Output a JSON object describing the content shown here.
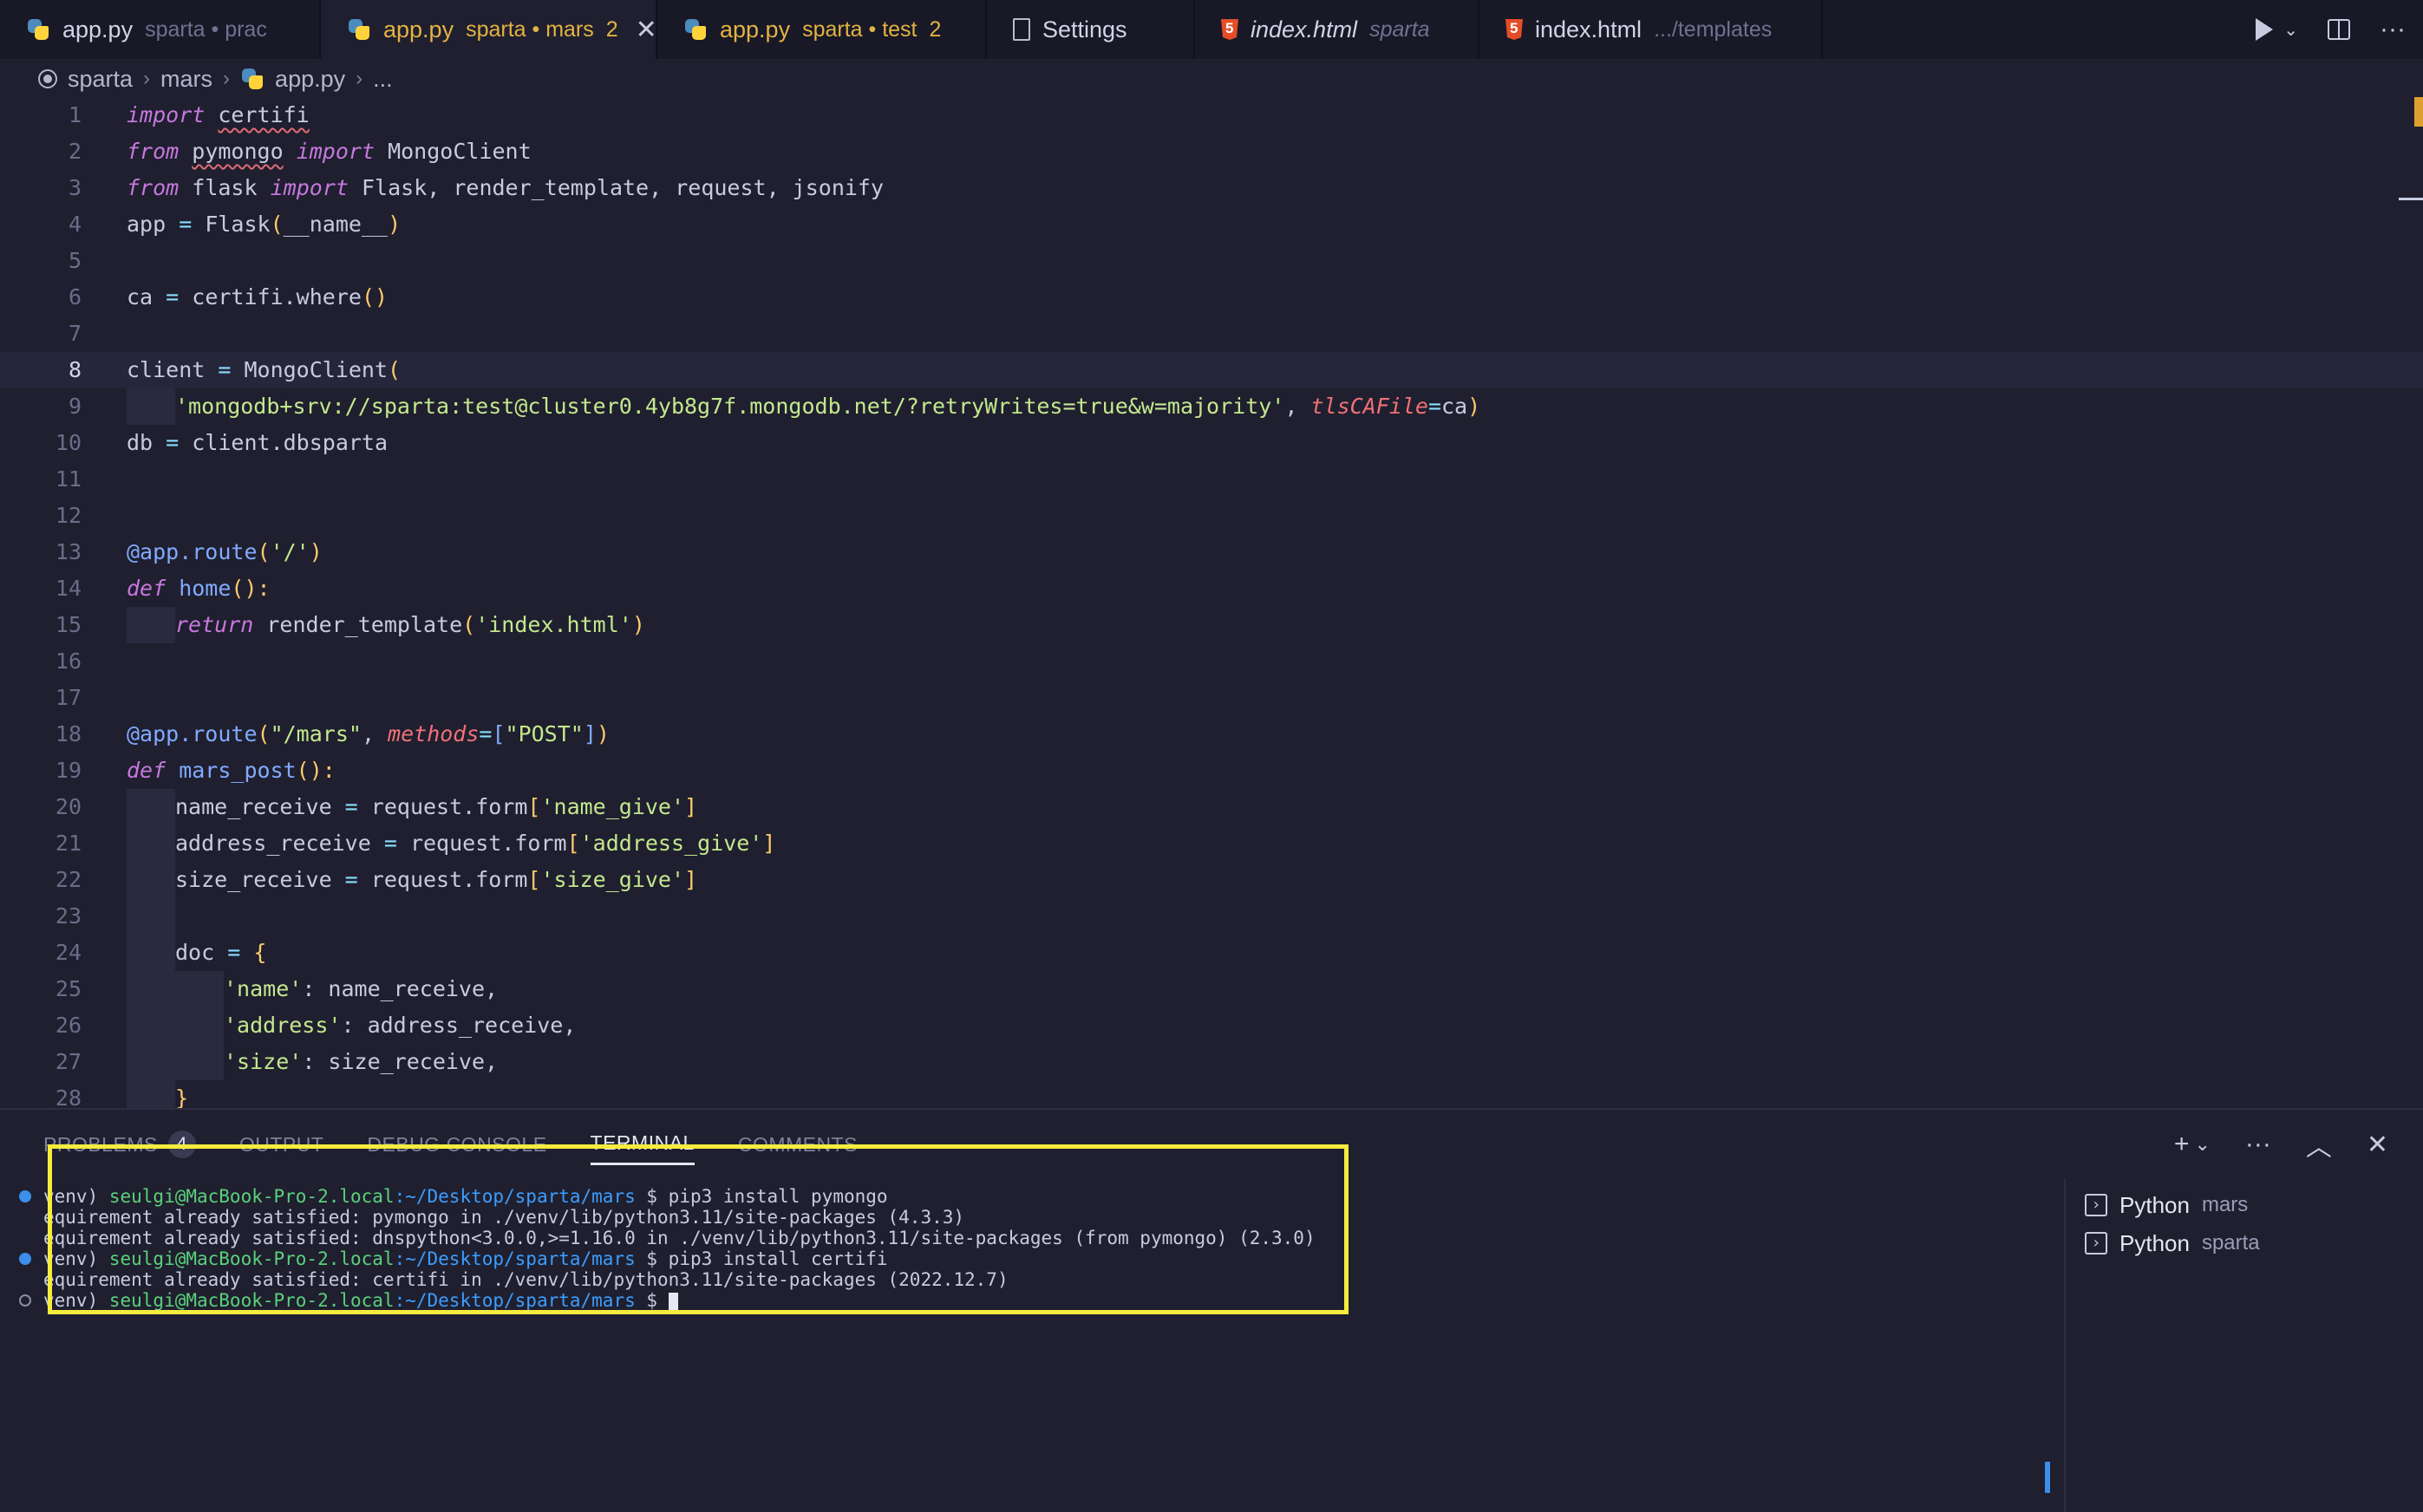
{
  "tabs": [
    {
      "icon": "python-icon",
      "name": "app.py",
      "desc": "sparta • prac",
      "count": "",
      "active": false,
      "modified": false,
      "italic": false
    },
    {
      "icon": "python-icon",
      "name": "app.py",
      "desc": "sparta • mars",
      "count": "2",
      "active": true,
      "modified": true,
      "italic": false,
      "close": "✕"
    },
    {
      "icon": "python-icon",
      "name": "app.py",
      "desc": "sparta • test",
      "count": "2",
      "active": false,
      "modified": true,
      "italic": false
    },
    {
      "icon": "file-icon",
      "name": "Settings",
      "desc": "",
      "count": "",
      "active": false,
      "modified": false,
      "italic": false
    },
    {
      "icon": "html-icon",
      "name": "index.html",
      "desc": "sparta",
      "count": "",
      "active": false,
      "modified": false,
      "italic": true
    },
    {
      "icon": "html-icon",
      "name": "index.html",
      "desc": ".../templates",
      "count": "",
      "active": false,
      "modified": false,
      "italic": false
    }
  ],
  "breadcrumb": {
    "root": "sparta",
    "folder": "mars",
    "file": "app.py",
    "rest": "...",
    "sep": "›"
  },
  "editor": {
    "current_line": 8,
    "line_numbers": [
      "1",
      "2",
      "3",
      "4",
      "5",
      "6",
      "7",
      "8",
      "9",
      "10",
      "11",
      "12",
      "13",
      "14",
      "15",
      "16",
      "17",
      "18",
      "19",
      "20",
      "21",
      "22",
      "23",
      "24",
      "25",
      "26",
      "27",
      "28"
    ],
    "code": {
      "l1": {
        "kw": "import",
        "mod": "certifi"
      },
      "l2": {
        "kw1": "from",
        "mod": "pymongo",
        "kw2": "import",
        "name": "MongoClient"
      },
      "l3": {
        "kw1": "from",
        "mod": "flask",
        "kw2": "import",
        "names": "Flask, render_template, request, jsonify"
      },
      "l4": {
        "a": "app ",
        "op": "=",
        "b": " Flask",
        "p1": "(",
        "c": "__name__",
        "p2": ")"
      },
      "l6": {
        "a": "ca ",
        "op": "=",
        "b": " certifi.where",
        "p": "()"
      },
      "l8": {
        "a": "client ",
        "op": "=",
        "b": " MongoClient",
        "p": "("
      },
      "l9": {
        "str": "'mongodb+srv://sparta:test@cluster0.4yb8g7f.mongodb.net/?retryWrites=true&w=majority'",
        "comma": ", ",
        "param": "tlsCAFile",
        "op": "=",
        "val": "ca",
        "p": ")"
      },
      "l10": {
        "a": "db ",
        "op": "=",
        "b": " client.dbsparta"
      },
      "l13": {
        "dec": "@app.route",
        "p1": "(",
        "str": "'/'",
        "p2": ")"
      },
      "l14": {
        "kw": "def",
        "fn": " home",
        "p": "():"
      },
      "l15": {
        "kw": "return",
        "b": " render_template",
        "p1": "(",
        "str": "'index.html'",
        "p2": ")"
      },
      "l18": {
        "dec": "@app.route",
        "p1": "(",
        "str": "\"/mars\"",
        "comma": ", ",
        "param": "methods",
        "op": "=",
        "b1": "[",
        "str2": "\"POST\"",
        "b2": "]",
        "p2": ")"
      },
      "l19": {
        "kw": "def",
        "fn": " mars_post",
        "p": "():"
      },
      "l20": {
        "a": "name_receive ",
        "op": "=",
        "b": " request.form",
        "b1": "[",
        "str": "'name_give'",
        "b2": "]"
      },
      "l21": {
        "a": "address_receive ",
        "op": "=",
        "b": " request.form",
        "b1": "[",
        "str": "'address_give'",
        "b2": "]"
      },
      "l22": {
        "a": "size_receive ",
        "op": "=",
        "b": " request.form",
        "b1": "[",
        "str": "'size_give'",
        "b2": "]"
      },
      "l24": {
        "a": "doc ",
        "op": "=",
        "p": " {"
      },
      "l25": {
        "str": "'name'",
        "rest": ": name_receive,"
      },
      "l26": {
        "str": "'address'",
        "rest": ": address_receive,"
      },
      "l27": {
        "str": "'size'",
        "rest": ": size_receive,"
      },
      "l28": {
        "p": "}"
      }
    }
  },
  "panel": {
    "tabs": [
      {
        "label": "PROBLEMS",
        "badge": "4",
        "active": false
      },
      {
        "label": "OUTPUT",
        "badge": "",
        "active": false
      },
      {
        "label": "DEBUG CONSOLE",
        "badge": "",
        "active": false
      },
      {
        "label": "TERMINAL",
        "badge": "",
        "active": true
      },
      {
        "label": "COMMENTS",
        "badge": "",
        "active": false
      }
    ],
    "actions": {
      "add": "+",
      "chevron": "⌄",
      "more": "···",
      "maximize": "︿",
      "close": "✕"
    },
    "terminal_lines": [
      {
        "dot": "filled",
        "pre": "venv) ",
        "user": "seulgi@MacBook-Pro-2.local",
        "path": ":~/Desktop/sparta/mars",
        "cmd": " $ pip3 install pymongo"
      },
      {
        "dot": "",
        "text": "equirement already satisfied: pymongo in ./venv/lib/python3.11/site-packages (4.3.3)"
      },
      {
        "dot": "",
        "text": "equirement already satisfied: dnspython<3.0.0,>=1.16.0 in ./venv/lib/python3.11/site-packages (from pymongo) (2.3.0)"
      },
      {
        "dot": "filled",
        "pre": "venv) ",
        "user": "seulgi@MacBook-Pro-2.local",
        "path": ":~/Desktop/sparta/mars",
        "cmd": " $ pip3 install certifi"
      },
      {
        "dot": "",
        "text": "equirement already satisfied: certifi in ./venv/lib/python3.11/site-packages (2022.12.7)"
      },
      {
        "dot": "hollow",
        "pre": "venv) ",
        "user": "seulgi@MacBook-Pro-2.local",
        "path": ":~/Desktop/sparta/mars",
        "cmd": " $ "
      }
    ],
    "terminals": [
      {
        "name": "Python",
        "desc": "mars"
      },
      {
        "name": "Python",
        "desc": "sparta"
      }
    ]
  },
  "colors": {
    "highlight_box": "#f5ec3e",
    "modified": "#e3b341",
    "accent": "#3b8eea"
  }
}
